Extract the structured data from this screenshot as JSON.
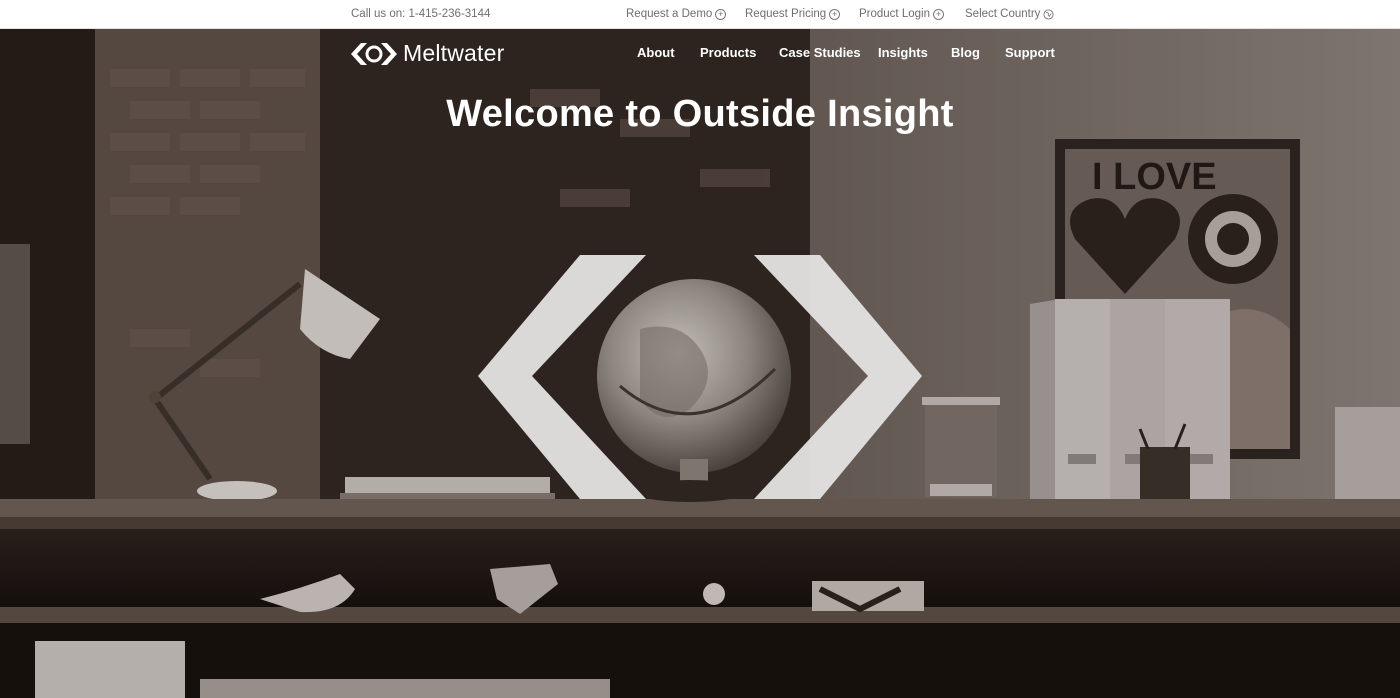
{
  "topbar": {
    "phone": "Call us on: 1-415-236-3144",
    "links": [
      {
        "label": "Request a Demo",
        "icon": "plus-circle-icon"
      },
      {
        "label": "Request Pricing",
        "icon": "plus-circle-icon"
      },
      {
        "label": "Product Login",
        "icon": "plus-circle-icon"
      },
      {
        "label": "Select Country",
        "icon": "globe-icon"
      }
    ]
  },
  "brand": {
    "name": "Meltwater",
    "logo_icon": "meltwater-eye-logo-icon"
  },
  "nav": {
    "items": [
      "About",
      "Products",
      "Case Studies",
      "Insights",
      "Blog",
      "Support"
    ]
  },
  "hero": {
    "title": "Welcome to Outside Insight",
    "poster_text": "I LOVE",
    "background": "office shelf with globe, desk lamp and poster (sepia photo)"
  },
  "colors": {
    "topbar_bg": "#ffffff",
    "topbar_text": "#6e6e6e",
    "nav_text": "#ffffff",
    "hero_overlay": "#2b2320"
  }
}
